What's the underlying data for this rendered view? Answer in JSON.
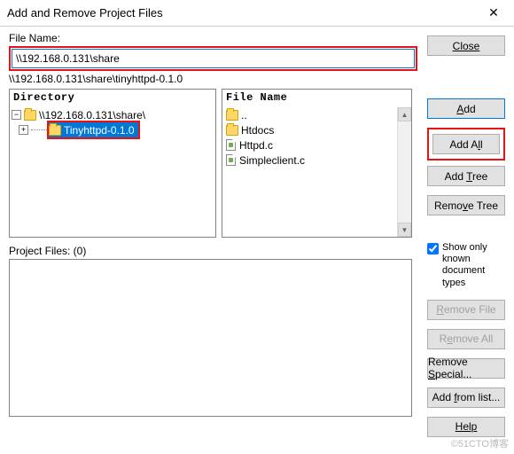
{
  "titlebar": {
    "title": "Add and Remove Project Files"
  },
  "labels": {
    "filename": "File Name:",
    "directory": "Directory",
    "filelist": "File Name",
    "projectfiles": "Project Files: (0)"
  },
  "input": {
    "filename_value": "\\\\192.168.0.131\\share",
    "path_text": "\\\\192.168.0.131\\share\\tinyhttpd-0.1.0"
  },
  "tree": {
    "root": "\\\\192.168.0.131\\share\\",
    "child": "Tinyhttpd-0.1.0"
  },
  "files": {
    "parent": "..",
    "items": [
      "Htdocs",
      "Httpd.c",
      "Simpleclient.c"
    ]
  },
  "buttons": {
    "close": "Close",
    "add": "Add",
    "addall": "Add All",
    "addtree": "Add Tree",
    "removetree": "Remove Tree",
    "removefile": "Remove File",
    "removeall": "Remove All",
    "removespecial": "Remove Special...",
    "addfromlist": "Add from list...",
    "help": "Help"
  },
  "checkbox": {
    "label": "Show only known document types"
  },
  "watermark": "©51CTO博客"
}
